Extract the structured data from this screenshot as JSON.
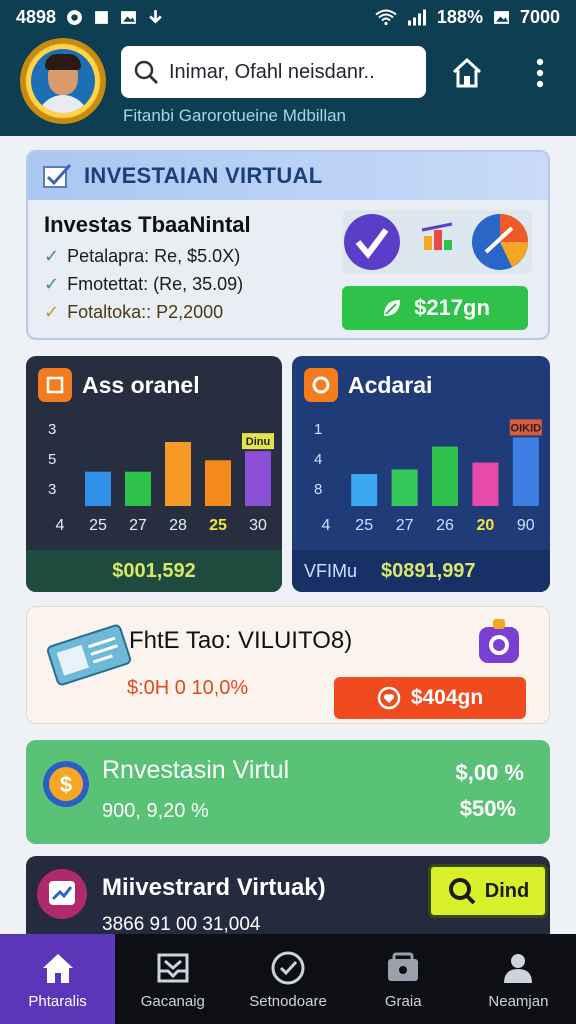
{
  "status": {
    "left_time": "4898",
    "battery": "188%",
    "right_value": "7000"
  },
  "header": {
    "search_text": "Inimar, Ofahl neisdanr..",
    "subtitle": "Fitanbi Garorotueine Mdbillan"
  },
  "invest_card": {
    "title": "INVESTAIAN VIRTUAL",
    "subtitle": "Investas TbaaNintal",
    "lines": [
      "Petalapra: Re, $5.0X)",
      "Fmotettat: (Re, 35.09)",
      "Fotaltoka:: P2,2000"
    ],
    "button_label": "$217gn"
  },
  "chart_left": {
    "title": "Ass oranel",
    "footer": "$001,592",
    "badge": "Dinu"
  },
  "chart_right": {
    "title": "Acdarai",
    "footer_label": "VFIMu",
    "footer": "$0891,997",
    "badge": "OIKID"
  },
  "fhte_card": {
    "title": "FhtE Tao: VILUITO8)",
    "percent": "$:0H 0 10,0%",
    "button_label": "$404gn"
  },
  "green_card": {
    "title": "Rnvestasin Virtul",
    "subtitle": "900, 9,20 %",
    "value_1": "$,00 %",
    "value_2": "$50%"
  },
  "dark_card": {
    "title": "Miivestrard Virtuak)",
    "subtitle": "3866 91 00 31,004",
    "button_label": "Dind"
  },
  "nav": [
    {
      "label": "Phtaralis"
    },
    {
      "label": "Gacanaig"
    },
    {
      "label": "Setnodoare"
    },
    {
      "label": "Graia"
    },
    {
      "label": "Neamjan"
    }
  ],
  "chart_data": [
    {
      "type": "bar",
      "title": "Ass oranel",
      "y_tick_labels": [
        "3",
        "5",
        "3"
      ],
      "categories": [
        "4",
        "25",
        "27",
        "28",
        "25",
        "30"
      ],
      "values": [
        0,
        30,
        30,
        56,
        40,
        48
      ],
      "bar_colors": [
        "#2e90e6",
        "#2fc24a",
        "#f59a25",
        "#f58a1a",
        "#8b4fd6"
      ],
      "footer_value": "$001,592",
      "grid": false
    },
    {
      "type": "bar",
      "title": "Acdarai",
      "y_tick_labels": [
        "1",
        "4",
        "8"
      ],
      "categories": [
        "4",
        "25",
        "27",
        "26",
        "20",
        "90"
      ],
      "values": [
        0,
        28,
        32,
        52,
        38,
        60
      ],
      "bar_colors": [
        "#3aa8f2",
        "#35c95a",
        "#2fc24a",
        "#e84aa8",
        "#3e7fe3"
      ],
      "footer_value": "$0891,997",
      "grid": false
    }
  ]
}
